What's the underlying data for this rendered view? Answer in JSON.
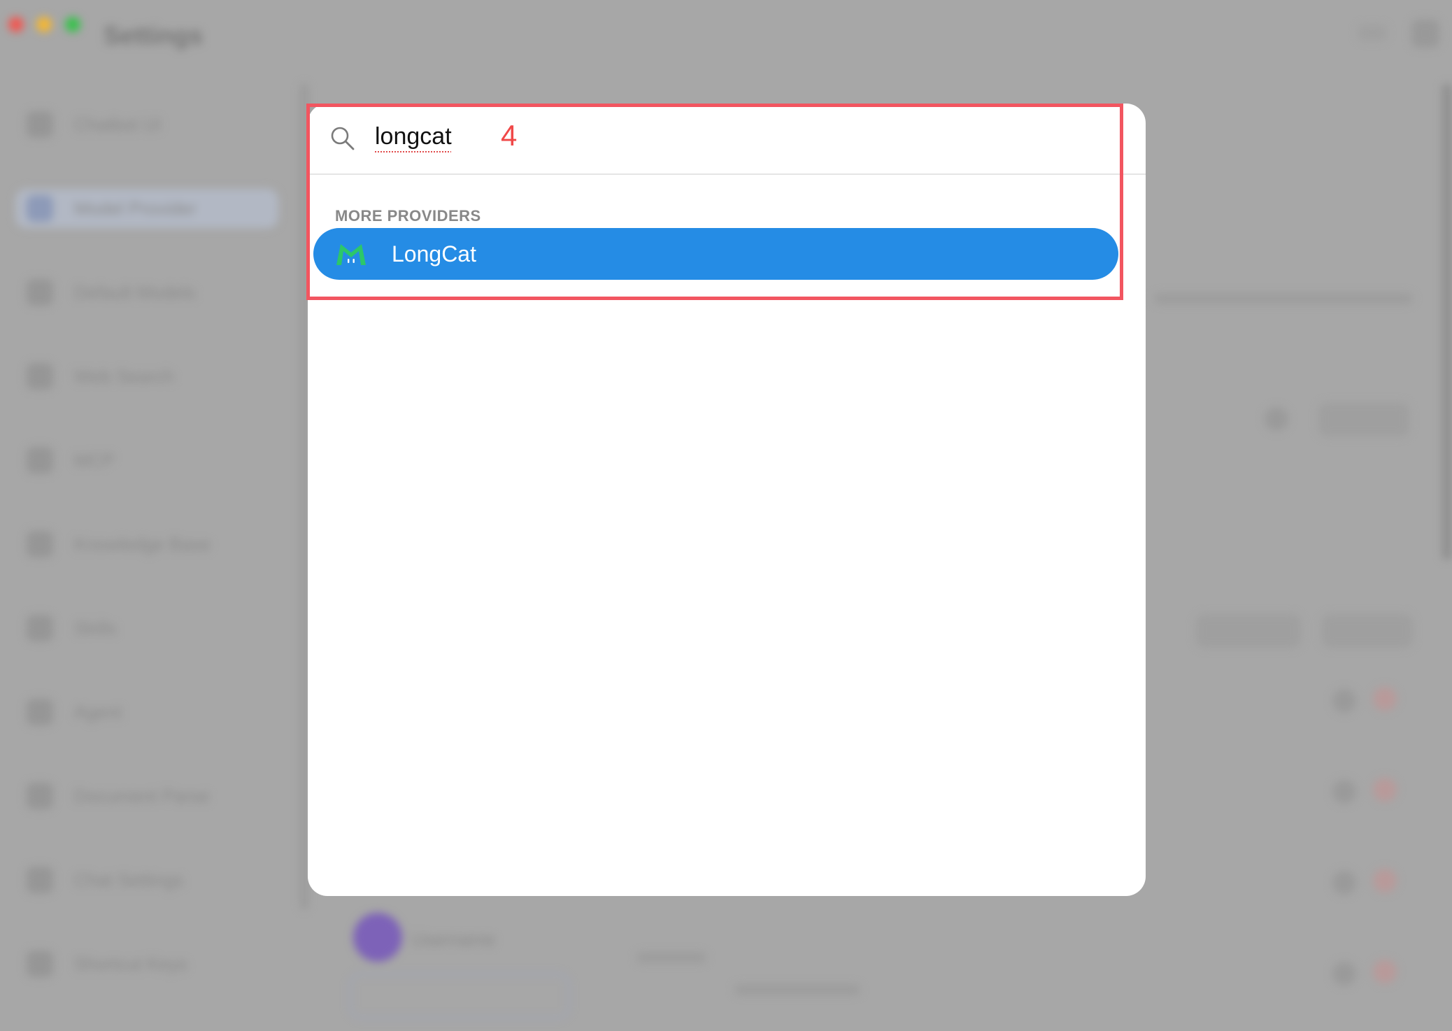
{
  "background": {
    "title": "Settings",
    "sidebar_items": [
      "Chatbot UI",
      "Model Provider",
      "Default Models",
      "Web Search",
      "MCP",
      "Knowledge Base",
      "Skills",
      "Agent",
      "Document Parse",
      "Chat Settings",
      "Shortcut Keys"
    ],
    "user_name": "Username"
  },
  "search": {
    "icon": "search-icon",
    "value": "longcat"
  },
  "annotation": {
    "step_number": "4"
  },
  "results": {
    "section_title": "MORE PROVIDERS",
    "items": [
      {
        "label": "LongCat",
        "icon": "longcat-logo-icon"
      }
    ]
  },
  "colors": {
    "selected_row": "#258ce5",
    "annotation_red": "#f25560",
    "logo_green": "#2cc76a"
  }
}
